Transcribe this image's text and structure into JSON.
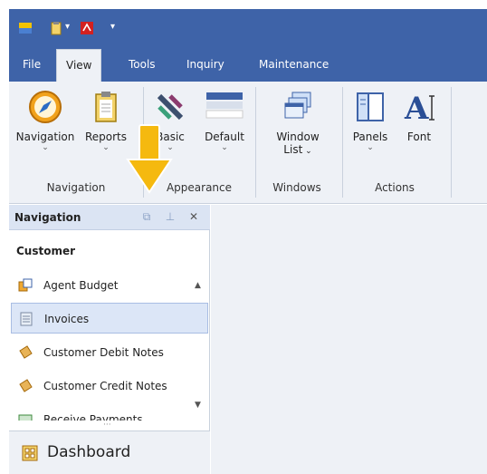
{
  "tabs": [
    {
      "label": "File",
      "active": false
    },
    {
      "label": "View",
      "active": true
    },
    {
      "label": "Tools",
      "active": false
    },
    {
      "label": "Inquiry",
      "active": false
    },
    {
      "label": "Maintenance",
      "active": false
    }
  ],
  "ribbon": {
    "navigation_btn": "Navigation",
    "reports_btn": "Reports",
    "basic_btn": "Basic",
    "default_btn": "Default",
    "window_list_btn_l1": "Window",
    "window_list_btn_l2": "List",
    "panels_btn": "Panels",
    "font_btn": "Font",
    "groups": {
      "navigation": "Navigation",
      "appearance": "Appearance",
      "windows": "Windows",
      "actions": "Actions"
    }
  },
  "navpane": {
    "title": "Navigation",
    "section": "Customer",
    "items": [
      {
        "label": "Agent Budget",
        "icon": "budget-icon"
      },
      {
        "label": "Invoices",
        "icon": "invoice-icon",
        "selected": true
      },
      {
        "label": "Customer Debit Notes",
        "icon": "debit-note-icon"
      },
      {
        "label": "Customer Credit Notes",
        "icon": "credit-note-icon"
      },
      {
        "label": "Receive Payments",
        "icon": "payment-icon"
      }
    ],
    "dashboard": "Dashboard"
  },
  "colors": {
    "title_blue": "#3e63a8",
    "ribbon_bg": "#eef1f6",
    "selected_bg": "#dce6f7",
    "arrow_yellow": "#f5b90f"
  }
}
